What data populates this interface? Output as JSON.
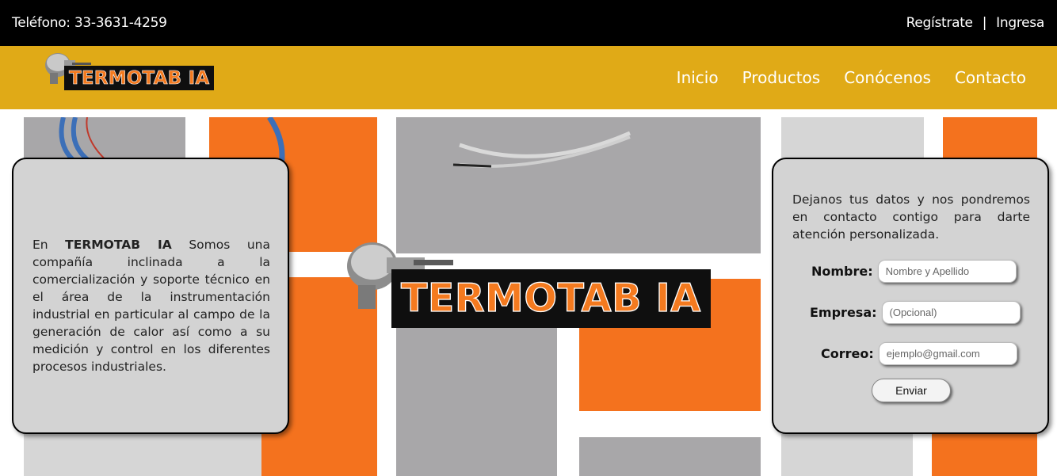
{
  "topbar": {
    "phone": "Teléfono: 33-3631-4259",
    "register": "Regístrate",
    "separator": "|",
    "login": "Ingresa"
  },
  "brand": {
    "name": "TERMOTAB IA",
    "accent_color": "#f47a1f",
    "bar_color": "#e0aa17"
  },
  "nav": {
    "items": [
      "Inicio",
      "Productos",
      "Conócenos",
      "Contacto"
    ]
  },
  "about": {
    "prefix": "En ",
    "company": "TERMOTAB IA",
    "body": " Somos una compañía inclinada a la comercialización y soporte técnico en el área de la instrumentación industrial en particular al campo de la generación de calor así como a su medición y control en los diferentes procesos industriales."
  },
  "contact": {
    "intro": "Dejanos tus datos y nos pondremos en contacto contigo para darte atención personalizada.",
    "name_label": "Nombre:",
    "name_placeholder": "Nombre y Apellido",
    "company_label": "Empresa:",
    "company_placeholder": "(Opcional)",
    "email_label": "Correo:",
    "email_placeholder": "ejemplo@gmail.com",
    "submit_label": "Enviar"
  }
}
